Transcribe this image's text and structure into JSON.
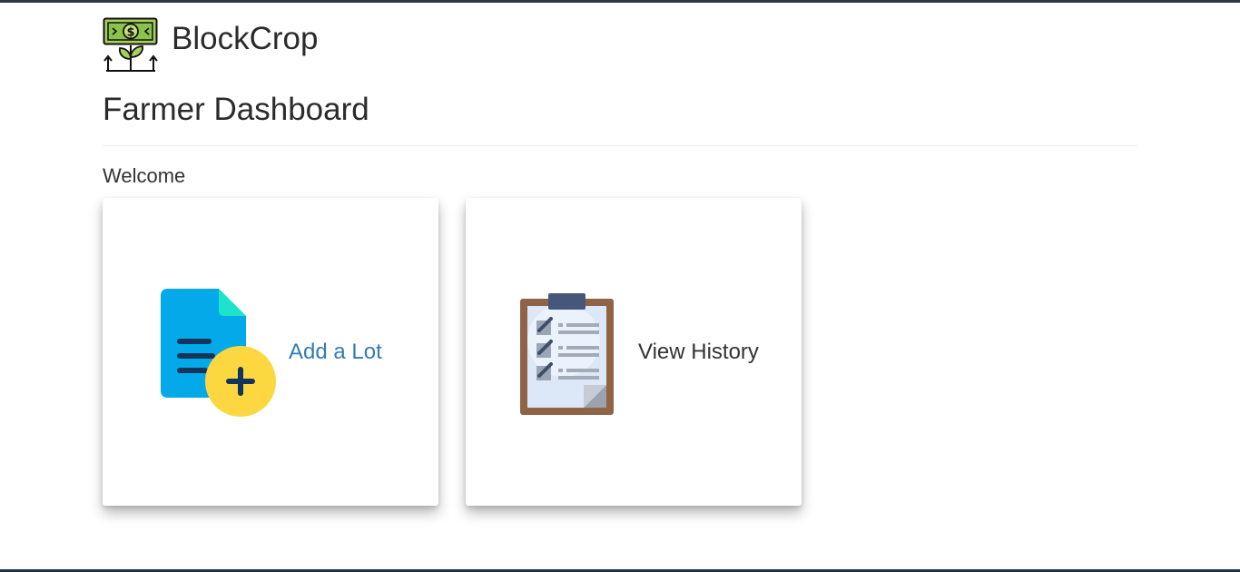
{
  "brand": {
    "name": "BlockCrop",
    "logo_icon": "money-plant-icon"
  },
  "header": {
    "title": "Farmer Dashboard"
  },
  "welcome_text": "Welcome",
  "cards": [
    {
      "label": "Add a Lot",
      "icon": "document-add-icon",
      "color": "#337ab7"
    },
    {
      "label": "View History",
      "icon": "clipboard-checklist-icon",
      "color": "#333333"
    }
  ],
  "colors": {
    "link": "#337ab7",
    "text": "#333333",
    "top_bar": "#2f3b44"
  }
}
